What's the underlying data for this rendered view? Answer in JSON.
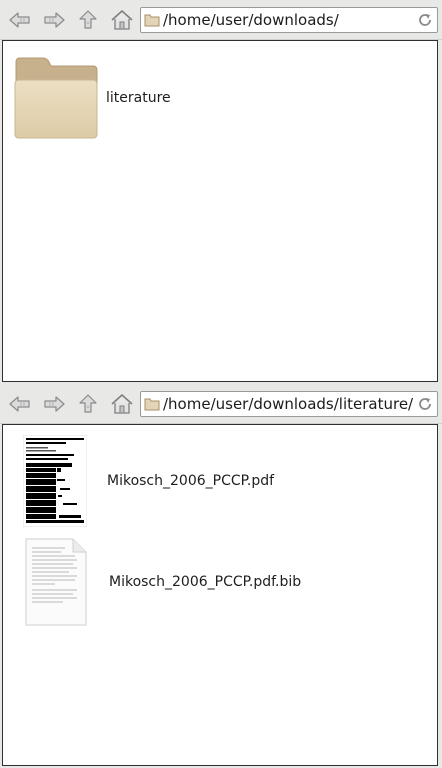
{
  "panes": [
    {
      "address_path": "/home/user/downloads/",
      "items": [
        {
          "label": "literature",
          "kind": "folder"
        }
      ]
    },
    {
      "address_path": "/home/user/downloads/literature/",
      "items": [
        {
          "label": "Mikosch_2006_PCCP.pdf",
          "kind": "pdf-thumbnail"
        },
        {
          "label": "Mikosch_2006_PCCP.pdf.bib",
          "kind": "text-document"
        }
      ]
    }
  ],
  "colors": {
    "folder": "#e3d4b6",
    "folder_tab": "#c9b48e",
    "toolbar": "#e8e8e7",
    "content_bg": "#ffffff"
  },
  "icons": {
    "back": "back-arrow-icon",
    "forward": "forward-arrow-icon",
    "up": "up-arrow-icon",
    "home": "home-icon",
    "reload": "reload-icon",
    "location": "folder-icon"
  }
}
